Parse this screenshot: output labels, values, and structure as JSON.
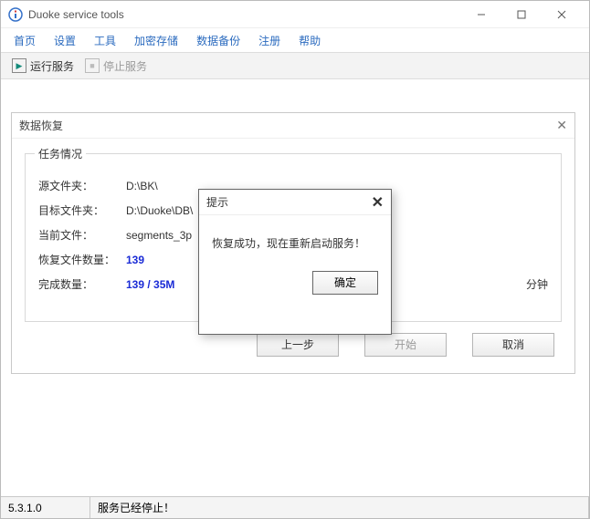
{
  "titlebar": {
    "title": "Duoke service tools"
  },
  "menubar": {
    "items": [
      "首页",
      "设置",
      "工具",
      "加密存储",
      "数据备份",
      "注册",
      "帮助"
    ]
  },
  "toolbar": {
    "run": "运行服务",
    "stop": "停止服务"
  },
  "dialog": {
    "title": "数据恢复",
    "group_legend": "任务情况",
    "rows": {
      "source_label": "源文件夹：",
      "source_val": "D:\\BK\\",
      "target_label": "目标文件夹：",
      "target_val": "D:\\Duoke\\DB\\",
      "current_label": "当前文件：",
      "current_val": "segments_3p",
      "count_label": "恢复文件数量：",
      "count_val": "139",
      "done_label": "完成数量：",
      "done_val": "139 / 35M",
      "done_tail": "分钟"
    },
    "buttons": {
      "prev": "上一步",
      "start": "开始",
      "cancel": "取消"
    }
  },
  "msgbox": {
    "title": "提示",
    "body": "恢复成功，现在重新启动服务！",
    "ok": "确定"
  },
  "statusbar": {
    "version": "5.3.1.0",
    "message": "服务已经停止！"
  }
}
